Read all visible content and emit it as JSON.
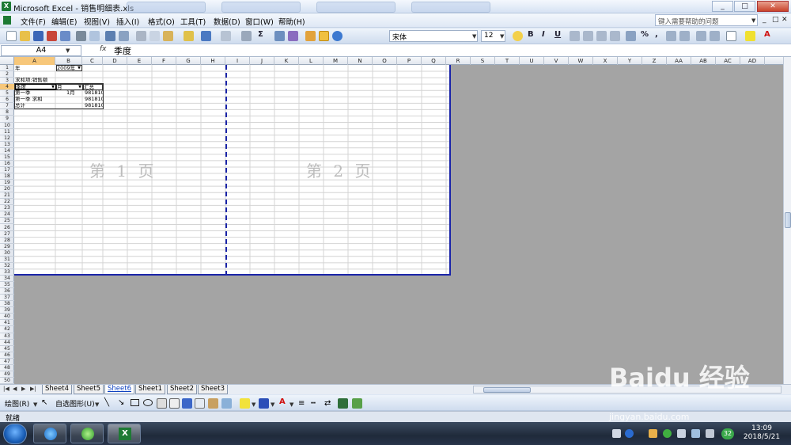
{
  "window": {
    "title": "Microsoft Excel - 销售明细表.xls",
    "app_icon_letter": "X",
    "controls": {
      "minimize": "_",
      "restore": "□",
      "close": "✕"
    }
  },
  "menu": {
    "items": [
      "文件(F)",
      "编辑(E)",
      "视图(V)",
      "插入(I)",
      "格式(O)",
      "工具(T)",
      "数据(D)",
      "窗口(W)",
      "帮助(H)"
    ],
    "help_placeholder": "键入需要帮助的问题",
    "mdi_controls": [
      "_",
      "□",
      "✕"
    ]
  },
  "toolbar": {
    "font_name": "宋体",
    "font_size": "12",
    "bold": "B",
    "italic": "I",
    "underline": "U",
    "sum": "Σ",
    "percent": "%",
    "comma": ","
  },
  "formula_bar": {
    "name_box": "A4",
    "fx": "fx",
    "content": "季度"
  },
  "columns": [
    "A",
    "B",
    "C",
    "D",
    "E",
    "F",
    "G",
    "H",
    "I",
    "J",
    "K",
    "L",
    "M",
    "N",
    "O",
    "P",
    "Q",
    "R",
    "S",
    "T",
    "U",
    "V",
    "W",
    "X",
    "Y",
    "Z",
    "AA",
    "AB",
    "AC",
    "AD"
  ],
  "rows_count": 50,
  "cells": {
    "a1": "年",
    "b1": "2009年",
    "a3": "求和项:销售额",
    "a4": "季度",
    "b4": "月",
    "c4": "汇总",
    "a5": "第一季",
    "b5": "1月",
    "c5": "981810",
    "a6": "第一季 求和",
    "c6": "981810",
    "a7": "总计",
    "c7": "981810"
  },
  "page_watermarks": [
    "第 1 页",
    "第 2 页"
  ],
  "sheets": {
    "tabs": [
      "Sheet4",
      "Sheet5",
      "Sheet6",
      "Sheet1",
      "Sheet2",
      "Sheet3"
    ],
    "active": "Sheet6"
  },
  "draw_toolbar": {
    "draw_label": "绘图(R)",
    "autoshape_label": "自选图形(U)"
  },
  "status": {
    "text": "就绪"
  },
  "taskbar": {
    "time": "13:09",
    "date": "2018/5/21",
    "badge": "32"
  },
  "watermark": {
    "brand": "Baidu 经验",
    "url": "jingyan.baidu.com"
  },
  "colors": {
    "page_border": "#1a24a8",
    "gray_area": "#a4a4a4",
    "ribbon_bg": "#dce6f4"
  }
}
